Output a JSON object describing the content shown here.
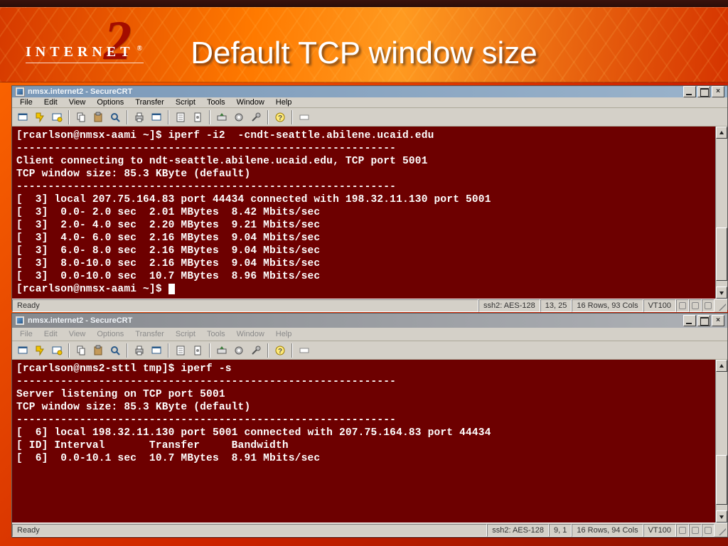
{
  "slide": {
    "logo_text": "INTERNET",
    "logo_reg": "®",
    "logo_number": "2",
    "title": "Default TCP window size"
  },
  "windows": {
    "top": {
      "titlebar": "nmsx.internet2 - SecureCRT",
      "menus": [
        "File",
        "Edit",
        "View",
        "Options",
        "Transfer",
        "Script",
        "Tools",
        "Window",
        "Help"
      ],
      "terminal_lines": [
        "[rcarlson@nmsx-aami ~]$ iperf -i2  -cndt-seattle.abilene.ucaid.edu",
        "------------------------------------------------------------",
        "Client connecting to ndt-seattle.abilene.ucaid.edu, TCP port 5001",
        "TCP window size: 85.3 KByte (default)",
        "------------------------------------------------------------",
        "[  3] local 207.75.164.83 port 44434 connected with 198.32.11.130 port 5001",
        "[  3]  0.0- 2.0 sec  2.01 MBytes  8.42 Mbits/sec",
        "[  3]  2.0- 4.0 sec  2.20 MBytes  9.21 Mbits/sec",
        "[  3]  4.0- 6.0 sec  2.16 MBytes  9.04 Mbits/sec",
        "[  3]  6.0- 8.0 sec  2.16 MBytes  9.04 Mbits/sec",
        "[  3]  8.0-10.0 sec  2.16 MBytes  9.04 Mbits/sec",
        "[  3]  0.0-10.0 sec  10.7 MBytes  8.96 Mbits/sec",
        "[rcarlson@nmsx-aami ~]$ "
      ],
      "status": {
        "ready": "Ready",
        "ssh": "ssh2: AES-128",
        "cursor": "13, 25",
        "size": "16 Rows, 93 Cols",
        "term": "VT100"
      }
    },
    "bottom": {
      "titlebar": "nmsx.internet2 - SecureCRT",
      "menus": [
        "File",
        "Edit",
        "View",
        "Options",
        "Transfer",
        "Script",
        "Tools",
        "Window",
        "Help"
      ],
      "terminal_lines": [
        "[rcarlson@nms2-sttl tmp]$ iperf -s",
        "------------------------------------------------------------",
        "Server listening on TCP port 5001",
        "TCP window size: 85.3 KByte (default)",
        "------------------------------------------------------------",
        "[  6] local 198.32.11.130 port 5001 connected with 207.75.164.83 port 44434",
        "[ ID] Interval       Transfer     Bandwidth",
        "[  6]  0.0-10.1 sec  10.7 MBytes  8.91 Mbits/sec"
      ],
      "status": {
        "ready": "Ready",
        "ssh": "ssh2: AES-128",
        "cursor": "9,  1",
        "size": "16 Rows, 94 Cols",
        "term": "VT100"
      }
    }
  }
}
